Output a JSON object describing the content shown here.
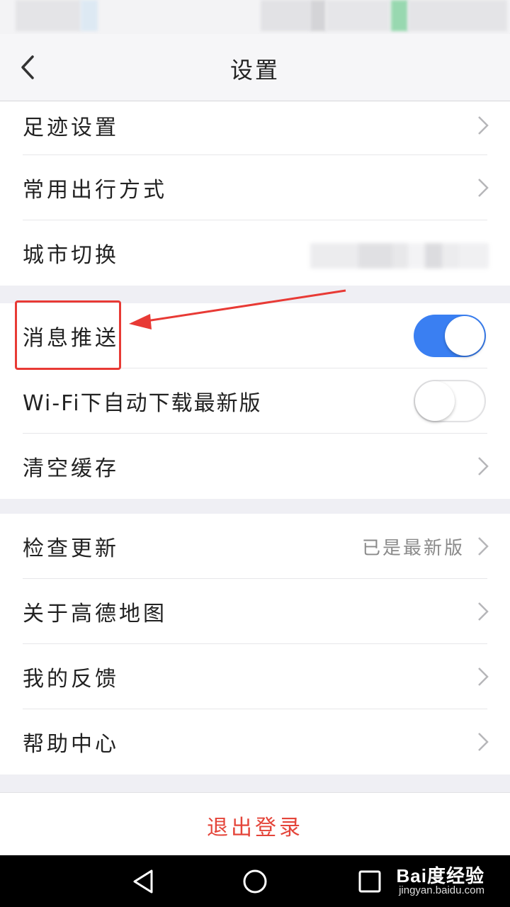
{
  "header": {
    "title": "设置"
  },
  "sections": [
    [
      {
        "label": "足迹设置",
        "type": "link"
      },
      {
        "label": "常用出行方式",
        "type": "link"
      },
      {
        "label": "城市切换",
        "type": "value-blurred"
      }
    ],
    [
      {
        "label": "消息推送",
        "type": "toggle",
        "on": true
      },
      {
        "label": "Wi-Fi下自动下载最新版",
        "type": "toggle",
        "on": false
      },
      {
        "label": "清空缓存",
        "type": "link"
      }
    ],
    [
      {
        "label": "检查更新",
        "type": "link",
        "value": "已是最新版"
      },
      {
        "label": "关于高德地图",
        "type": "link"
      },
      {
        "label": "我的反馈",
        "type": "link"
      },
      {
        "label": "帮助中心",
        "type": "link"
      }
    ]
  ],
  "logout": {
    "label": "退出登录"
  },
  "watermark": {
    "brand": "Bai度经验",
    "url": "jingyan.baidu.com"
  },
  "colors": {
    "accent": "#3a7ff2",
    "danger": "#e4453a",
    "annotation": "#e83a35"
  },
  "icons": {
    "back": "chevron-left-icon",
    "row": "chevron-right-icon",
    "sys_back": "triangle-back-icon",
    "sys_home": "circle-home-icon",
    "sys_recent": "square-recent-icon"
  }
}
